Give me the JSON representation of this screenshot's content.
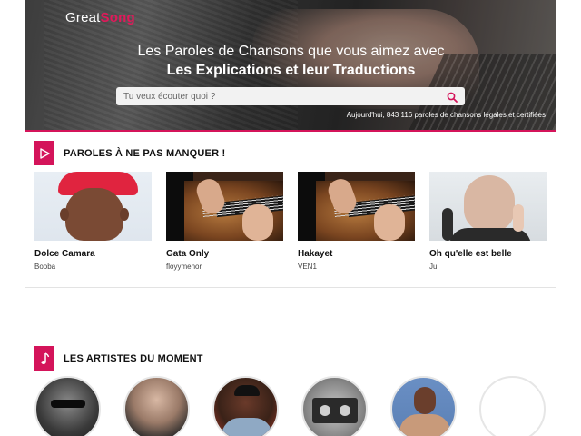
{
  "brand": {
    "part1": "Great",
    "part2": "Song"
  },
  "hero": {
    "line1": "Les Paroles de Chansons que vous aimez avec",
    "line2": "Les Explications et leur Traductions",
    "stats": "Aujourd'hui, 843 116 paroles de chansons légales et certifiées"
  },
  "search": {
    "placeholder": "Tu veux écouter quoi ?"
  },
  "sections": {
    "featured": {
      "title": "PAROLES À NE PAS MANQUER !",
      "items": [
        {
          "title": "Dolce Camara",
          "artist": "Booba"
        },
        {
          "title": "Gata Only",
          "artist": "floyymenor"
        },
        {
          "title": "Hakayet",
          "artist": "VEN1"
        },
        {
          "title": "Oh qu'elle est belle",
          "artist": "Jul"
        }
      ]
    },
    "artists": {
      "title": "LES ARTISTES DU MOMENT"
    }
  },
  "colors": {
    "accent": "#d4145a",
    "brand_song": "#e0195a"
  },
  "icons": {
    "search": "search-icon",
    "play": "play-icon",
    "music": "music-note-icon"
  }
}
